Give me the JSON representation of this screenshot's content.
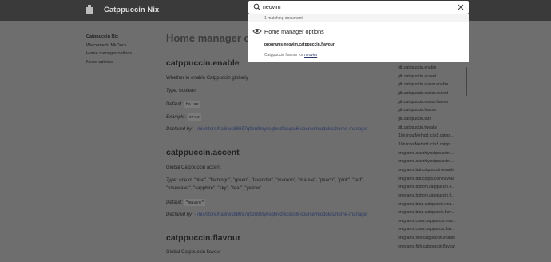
{
  "header": {
    "site_title": "Catppuccin Nix"
  },
  "nav": {
    "items": [
      {
        "label": "Catppuccin Nix"
      },
      {
        "label": "Welcome to MkDocs"
      },
      {
        "label": "Home manager options"
      },
      {
        "label": "Nixos options"
      }
    ]
  },
  "main": {
    "page_title": "Home manager options",
    "options": [
      {
        "name": "catppuccin.enable",
        "description": "Whether to enable Catppuccin globally",
        "type_label": "Type:",
        "type_value": "boolean",
        "default_label": "Default:",
        "default_value": "false",
        "example_label": "Example:",
        "example_value": "true",
        "declared_label": "Declared by:",
        "declared_value": "- /nix/store/ha3rws88697qfxm9myksqfxvdfkcqss6-source/modules/home-manager"
      },
      {
        "name": "catppuccin.accent",
        "description": "Global Catppuccin accent",
        "type_label": "Type:",
        "type_value_line1": "one of \"blue\", \"flamingo\", \"green\", \"lavender\", \"maroon\", \"mauve\", \"peach\", \"pink\", \"red\",",
        "type_value_line2": "\"rosewater\", \"sapphire\", \"sky\", \"teal\", \"yellow\"",
        "default_label": "Default:",
        "default_value": "\"mauve\"",
        "declared_label": "Declared by:",
        "declared_value": "- /nix/store/ha3rws88697qfxm9myksqfxvdfkcqss6-source/modules/home-manager"
      },
      {
        "name": "catppuccin.flavour",
        "description": "Global Catppuccin flavour"
      }
    ]
  },
  "toc": {
    "items": [
      "gtk.catppuccin.enable",
      "gtk.catppuccin.accent",
      "gtk.catppuccin.cursor.enable",
      "gtk.catppuccin.cursor.accent",
      "gtk.catppuccin.cursor.flavour",
      "gtk.catppuccin.flavour",
      "gtk.catppuccin.size",
      "gtk.catppuccin.tweaks",
      "i18n.inputMethod.fcitx5.catpp...",
      "i18n.inputMethod.fcitx5.catpp...",
      "programs.alacritty.catppuccin....",
      "programs.alacritty.catppuccin....",
      "programs.bat.catppuccin.enable",
      "programs.bat.catppuccin.flavour",
      "programs.bottom.catppuccin.e...",
      "programs.bottom.catppuccin.fl...",
      "programs.btop.catppuccin.ena...",
      "programs.btop.catppuccin.flav...",
      "programs.cava.catppuccin.ena...",
      "programs.cava.catppuccin.flav...",
      "programs.fish.catppuccin.enable",
      "programs.fish.catppuccin.flavour"
    ]
  },
  "search": {
    "query": "neovim",
    "meta": "1 matching document",
    "result_title": "Home manager options",
    "result_subtitle": "programs.neovim.catppuccin.flavour",
    "result_desc_prefix": "Catppuccin flavour for ",
    "result_desc_match": "neovim"
  },
  "icons": {
    "logo": "logo-icon",
    "search": "search-icon",
    "close": "close-icon",
    "doc": "document-icon"
  },
  "colors": {
    "header_bg": "#3a3a3a",
    "page_bg": "#6e6e6e",
    "link": "#2a3a66"
  }
}
